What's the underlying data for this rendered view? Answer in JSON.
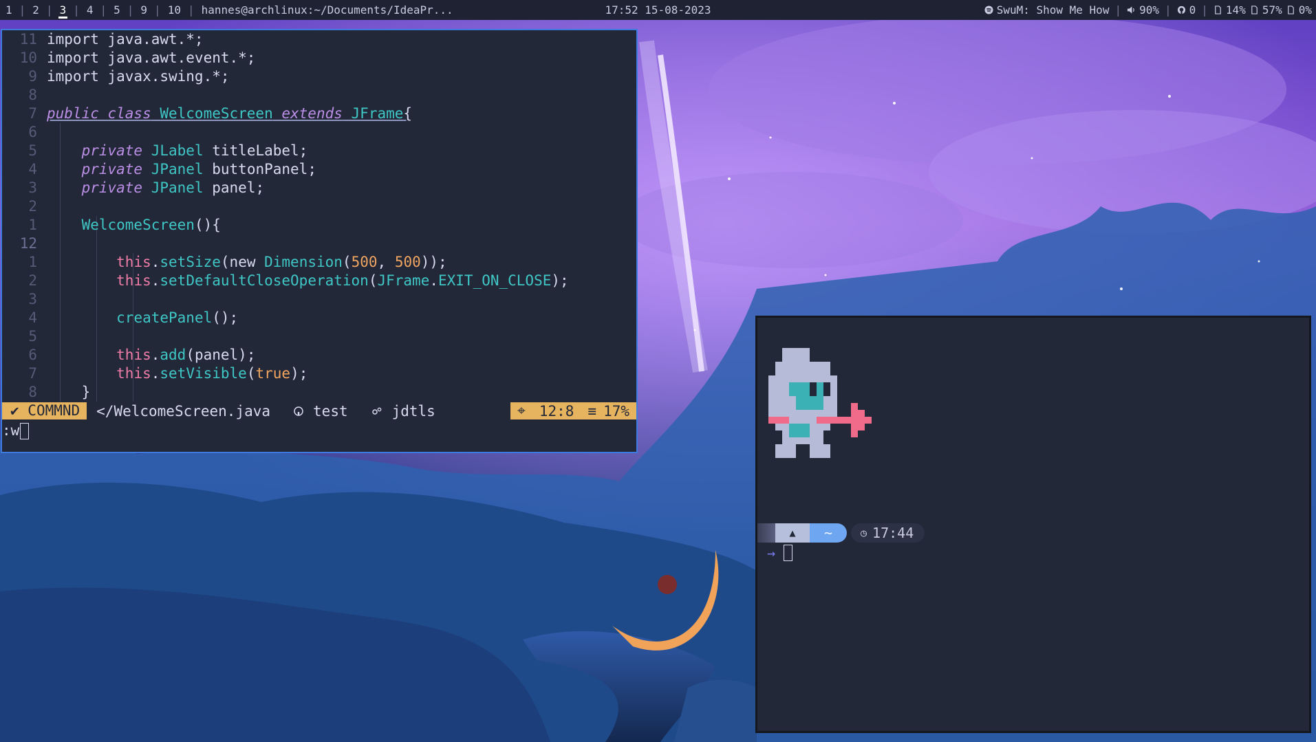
{
  "topbar": {
    "workspaces": [
      "1",
      "2",
      "3",
      "4",
      "5",
      "9",
      "10"
    ],
    "active_workspace": "3",
    "window_title": "hannes@archlinux:~/Documents/IdeaPr...",
    "clock": "17:52 15-08-2023",
    "spotify": "SwuM: Show Me How",
    "volume": "90%",
    "github": "0",
    "disk1": "14%",
    "disk2": "57%",
    "disk3": "0%"
  },
  "editor": {
    "mode": "COMMND",
    "file": "</WelcomeScreen.java",
    "git_branch": "test",
    "lsp": "jdtls",
    "position": "12:8",
    "percent": "17%",
    "command": ":w",
    "lines": [
      {
        "n": "11",
        "tokens": [
          [
            "t",
            "import java.awt.*;"
          ]
        ]
      },
      {
        "n": "10",
        "tokens": [
          [
            "t",
            "import java.awt.event.*;"
          ]
        ]
      },
      {
        "n": "9",
        "tokens": [
          [
            "t",
            "import javax.swing.*;"
          ]
        ]
      },
      {
        "n": "8",
        "tokens": []
      },
      {
        "n": "7",
        "tokens": [
          [
            "pu",
            "public class"
          ],
          [
            "tu",
            " WelcomeScreen"
          ],
          [
            "pu",
            " extends"
          ],
          [
            "tu",
            " JFrame"
          ],
          [
            "tu2",
            "{"
          ]
        ]
      },
      {
        "n": "6",
        "tokens": []
      },
      {
        "n": "5",
        "tokens": [
          [
            "t",
            "    "
          ],
          [
            "p",
            "private"
          ],
          [
            "c",
            " JLabel"
          ],
          [
            "t",
            " titleLabel;"
          ]
        ]
      },
      {
        "n": "4",
        "tokens": [
          [
            "t",
            "    "
          ],
          [
            "p",
            "private"
          ],
          [
            "c",
            " JPanel"
          ],
          [
            "t",
            " buttonPanel;"
          ]
        ]
      },
      {
        "n": "3",
        "tokens": [
          [
            "t",
            "    "
          ],
          [
            "p",
            "private"
          ],
          [
            "c",
            " JPanel"
          ],
          [
            "t",
            " panel;"
          ]
        ]
      },
      {
        "n": "2",
        "tokens": []
      },
      {
        "n": "1",
        "tokens": [
          [
            "t",
            "    "
          ],
          [
            "c",
            "WelcomeScreen"
          ],
          [
            "t",
            "(){"
          ]
        ]
      },
      {
        "n": "12",
        "tokens": []
      },
      {
        "n": "1",
        "tokens": [
          [
            "t",
            "        "
          ],
          [
            "k",
            "this"
          ],
          [
            "t",
            "."
          ],
          [
            "c",
            "setSize"
          ],
          [
            "t",
            "(new "
          ],
          [
            "c",
            "Dimension"
          ],
          [
            "t",
            "("
          ],
          [
            "o",
            "500"
          ],
          [
            "t",
            ", "
          ],
          [
            "o",
            "500"
          ],
          [
            "t",
            "));"
          ]
        ]
      },
      {
        "n": "2",
        "tokens": [
          [
            "t",
            "        "
          ],
          [
            "k",
            "this"
          ],
          [
            "t",
            "."
          ],
          [
            "c",
            "setDefaultCloseOperation"
          ],
          [
            "t",
            "("
          ],
          [
            "c",
            "JFrame"
          ],
          [
            "t",
            "."
          ],
          [
            "c",
            "EXIT_ON_CLOSE"
          ],
          [
            "t",
            ");"
          ]
        ]
      },
      {
        "n": "3",
        "tokens": []
      },
      {
        "n": "4",
        "tokens": [
          [
            "t",
            "        "
          ],
          [
            "c",
            "createPanel"
          ],
          [
            "t",
            "();"
          ]
        ]
      },
      {
        "n": "5",
        "tokens": []
      },
      {
        "n": "6",
        "tokens": [
          [
            "t",
            "        "
          ],
          [
            "k",
            "this"
          ],
          [
            "t",
            "."
          ],
          [
            "c",
            "add"
          ],
          [
            "t",
            "(panel);"
          ]
        ]
      },
      {
        "n": "7",
        "tokens": [
          [
            "t",
            "        "
          ],
          [
            "k",
            "this"
          ],
          [
            "t",
            "."
          ],
          [
            "c",
            "setVisible"
          ],
          [
            "t",
            "("
          ],
          [
            "o",
            "true"
          ],
          [
            "t",
            ");"
          ]
        ]
      },
      {
        "n": "8",
        "tokens": [
          [
            "t",
            "    }"
          ]
        ]
      }
    ]
  },
  "terminal": {
    "prompt_dir": "~",
    "prompt_time": "17:44",
    "prompt_arrow": "→"
  },
  "colors": {
    "accent_border": "#3d7be0",
    "mode_bg": "#e6b35e",
    "editor_bg": "#232838"
  }
}
